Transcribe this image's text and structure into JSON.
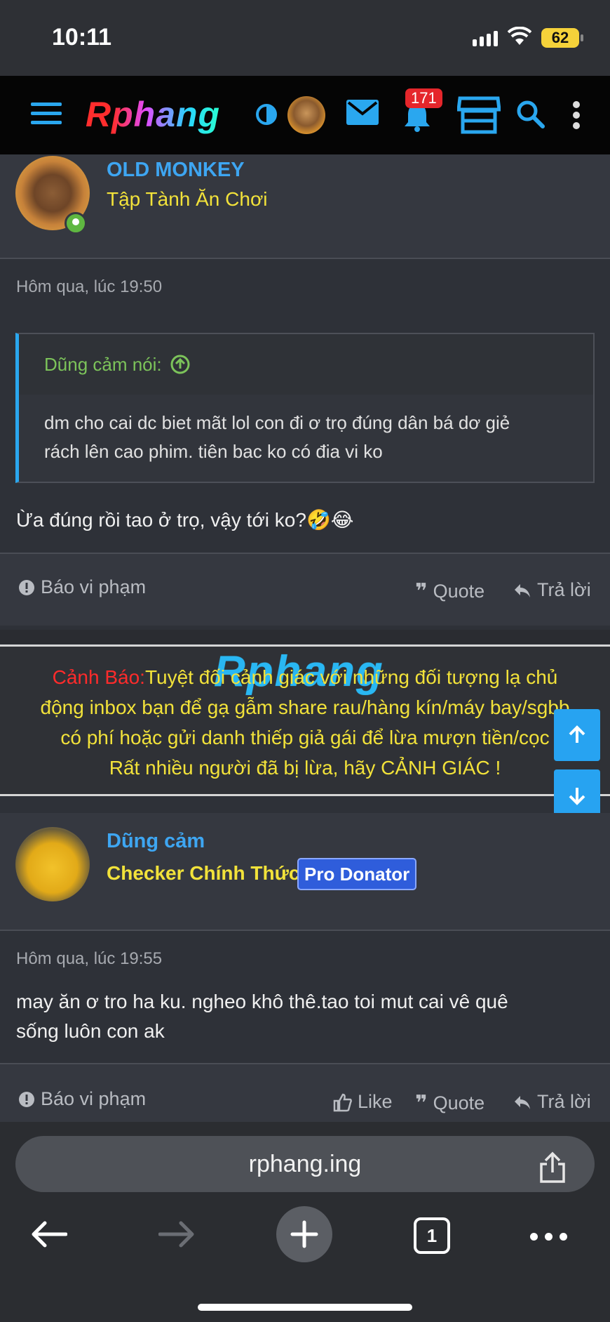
{
  "status": {
    "time": "10:11",
    "battery": "62"
  },
  "nav": {
    "logo": "Rphang",
    "notifications_count": "171"
  },
  "post1": {
    "username": "OLD MONKEY",
    "user_title": "Tập Tành Ăn Chơi",
    "timestamp": "Hôm qua, lúc 19:50",
    "quote_author": "Dũng cảm nói:",
    "quote_text_line1": "dm cho cai dc biet mãt lol con đi ơ trọ đúng dân bá dơ giẻ",
    "quote_text_line2": "rách lên cao phim. tiên bac ko có đia vi ko",
    "text": "Ừa đúng rồi tao ở trọ, vậy tới ko?🤣😂",
    "actions": {
      "report": "Báo vi phạm",
      "quote": "Quote",
      "reply": "Trả lời"
    }
  },
  "warning": {
    "watermark_a": "Rp",
    "watermark_b": "hang",
    "label": "Cảnh Báo:",
    "line1": "Tuyệt đối cảnh giác với những đối tượng lạ chủ",
    "line2": "động inbox bạn để gạ gẫm share rau/hàng kín/máy bay/sgbb",
    "line3": "có phí hoặc gửi danh thiếp giả gái để lừa mượn tiền/cọc",
    "line4": "Rất nhiều người đã bị lừa, hãy CẢNH GIÁC !"
  },
  "post2": {
    "username": "Dũng cảm",
    "user_title": "Checker Chính Thức",
    "badge": "Pro Donator",
    "timestamp": "Hôm qua, lúc 19:55",
    "text_line1": "may ăn ơ tro ha ku. ngheo khô thê.tao toi mut cai vê quê",
    "text_line2": "sống luôn con ak",
    "actions": {
      "report": "Báo vi phạm",
      "like": "Like",
      "quote": "Quote",
      "reply": "Trả lời"
    }
  },
  "browser": {
    "url": "rphang.ing",
    "tab_count": "1"
  },
  "colors": {
    "accent_blue": "#2aa7ef",
    "title_yellow": "#f2e23a",
    "warning_red": "#ff2b2b",
    "badge_red": "#e5262b",
    "online_green": "#5fb741"
  }
}
